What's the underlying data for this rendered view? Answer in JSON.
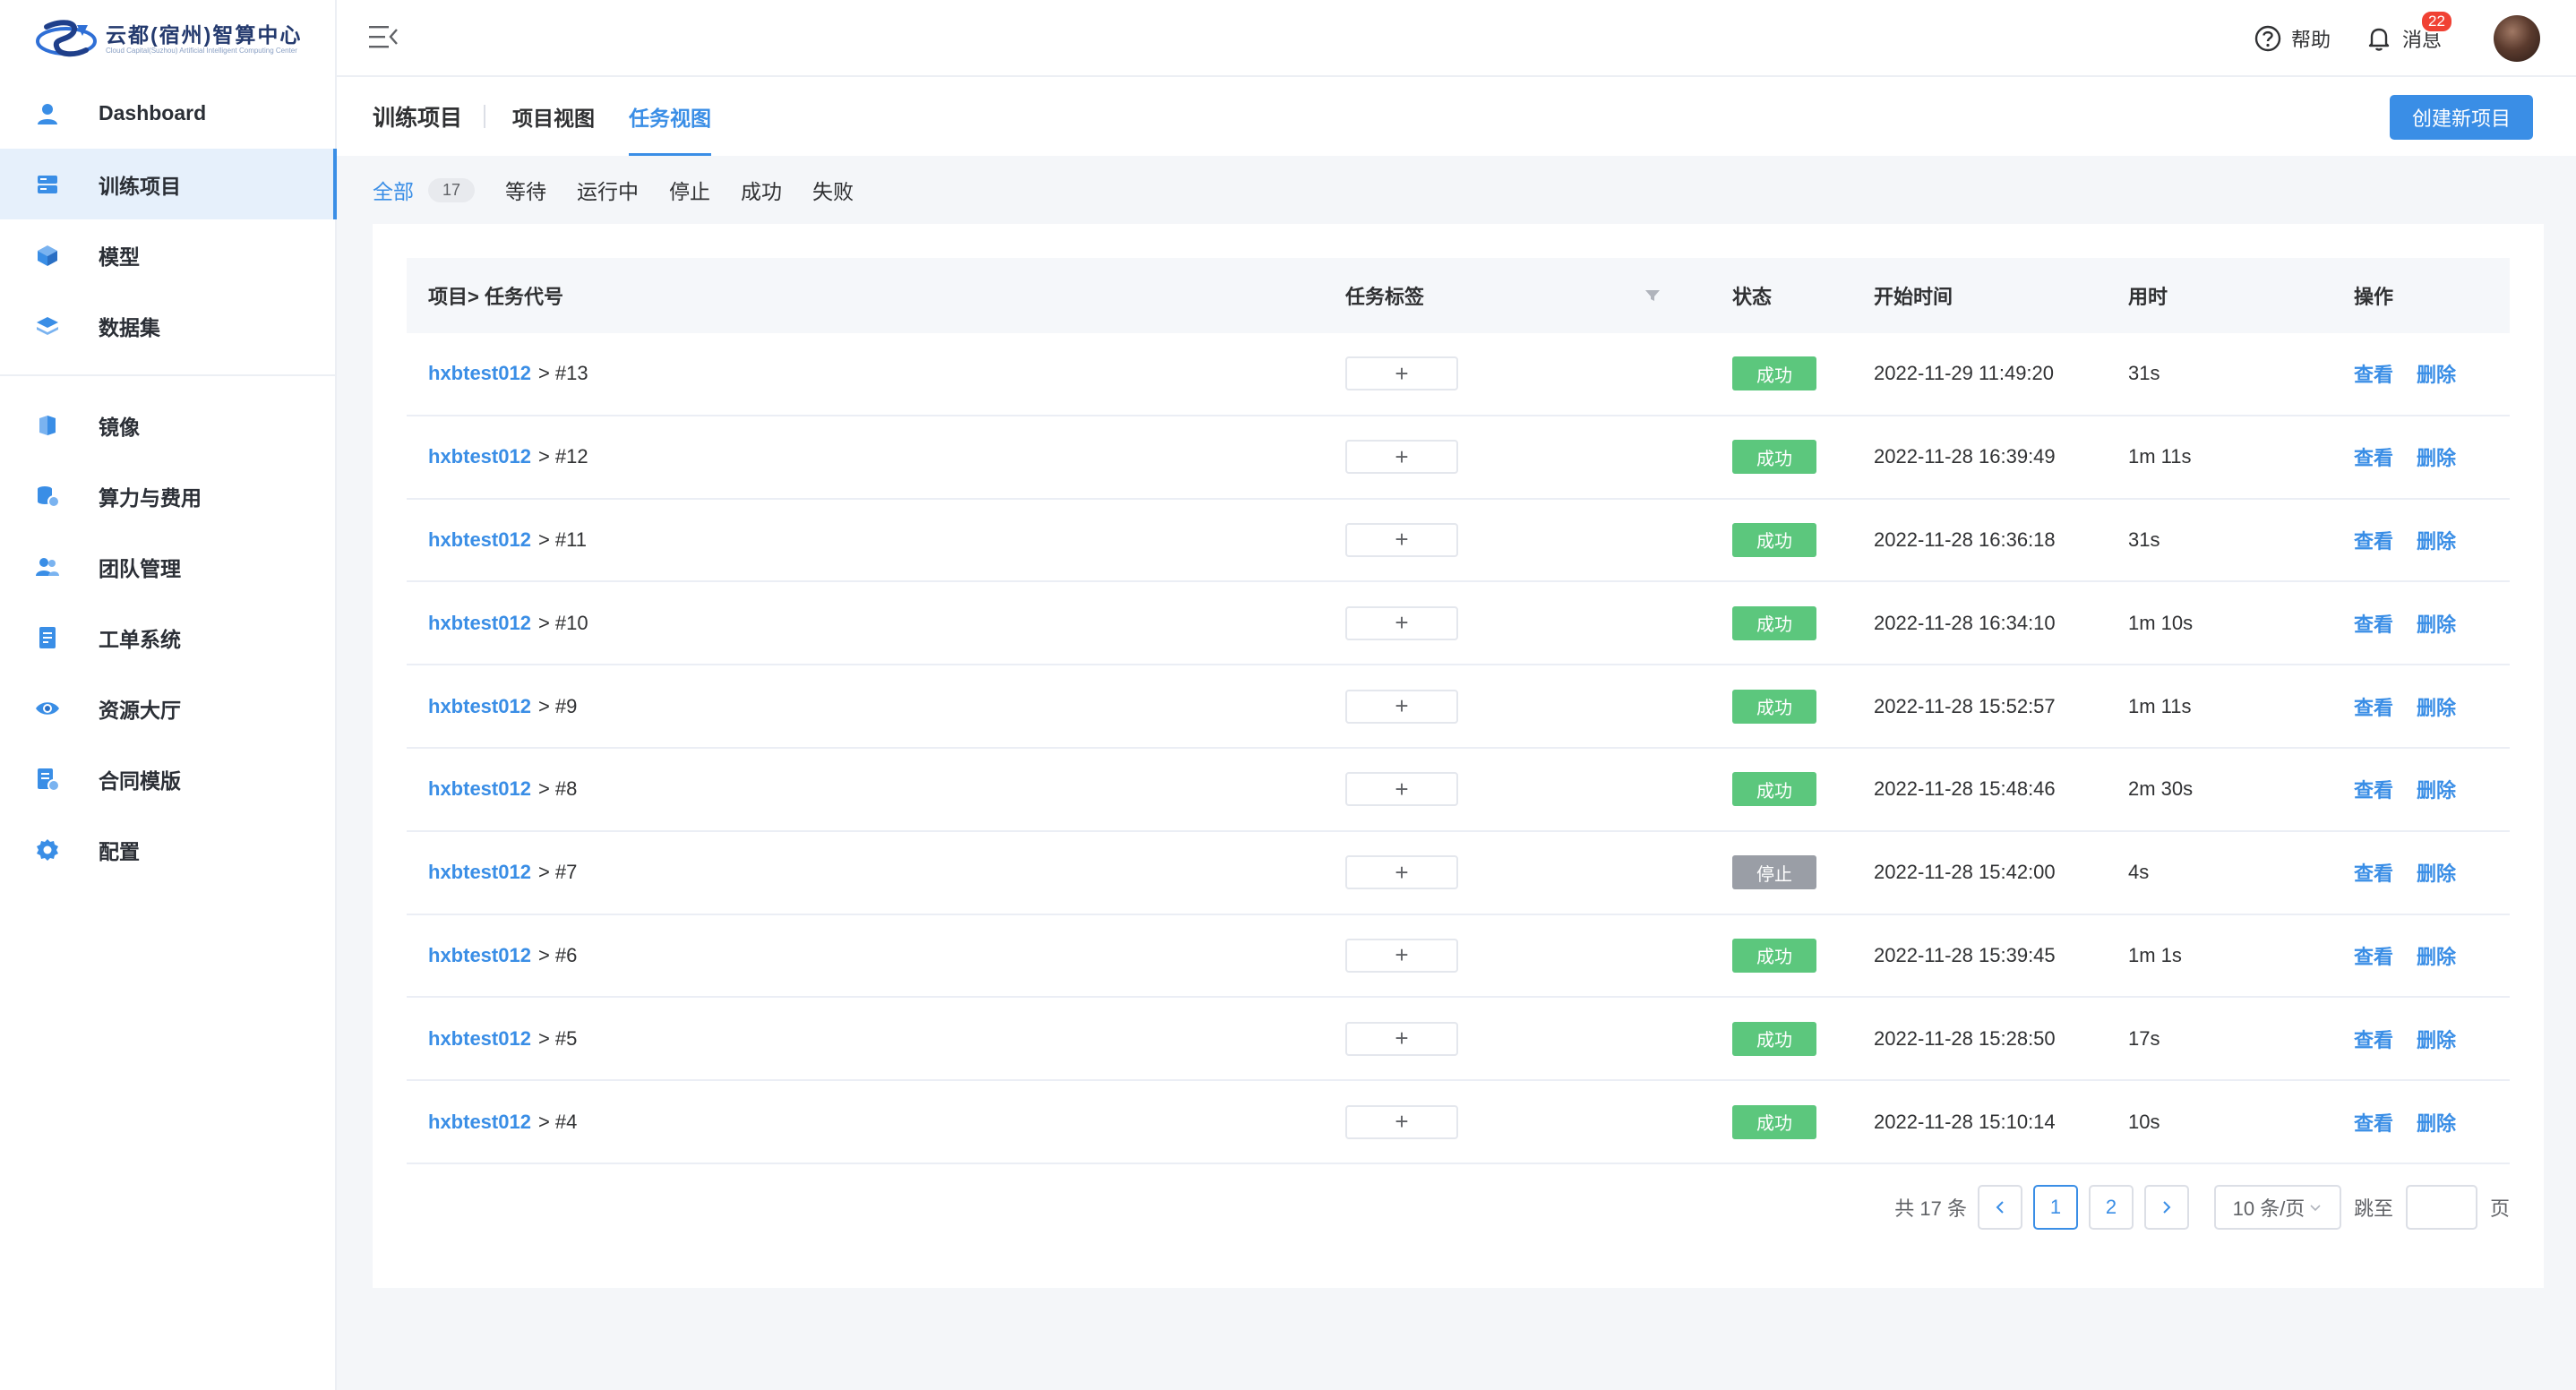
{
  "brand": {
    "title": "云都(宿州)智算中心",
    "subtitle": "Cloud Capital(Suzhou) Artificial Intelligent Computing Center"
  },
  "sidebar": {
    "items": [
      {
        "label": "Dashboard",
        "icon": "user-icon"
      },
      {
        "label": "训练项目",
        "icon": "server-icon",
        "active": true
      },
      {
        "label": "模型",
        "icon": "cube-icon"
      },
      {
        "label": "数据集",
        "icon": "layers-icon"
      },
      {
        "label": "镜像",
        "icon": "shield-icon"
      },
      {
        "label": "算力与费用",
        "icon": "compute-cost-icon"
      },
      {
        "label": "团队管理",
        "icon": "team-icon"
      },
      {
        "label": "工单系统",
        "icon": "ticket-icon"
      },
      {
        "label": "资源大厅",
        "icon": "eye-icon"
      },
      {
        "label": "合同模版",
        "icon": "contract-icon"
      },
      {
        "label": "配置",
        "icon": "gear-icon"
      }
    ]
  },
  "header": {
    "help_label": "帮助",
    "messages_label": "消息",
    "messages_count": "22"
  },
  "subheader": {
    "title": "训练项目",
    "tabs": [
      {
        "label": "项目视图",
        "active": false
      },
      {
        "label": "任务视图",
        "active": true
      }
    ],
    "create_label": "创建新项目"
  },
  "filters": {
    "all_label": "全部",
    "all_count": "17",
    "items": [
      "等待",
      "运行中",
      "停止",
      "成功",
      "失败"
    ]
  },
  "table": {
    "columns": {
      "task": "项目> 任务代号",
      "tags": "任务标签",
      "status": "状态",
      "start": "开始时间",
      "duration": "用时",
      "ops": "操作"
    },
    "add_tag_label": "+",
    "view_label": "查看",
    "delete_label": "删除",
    "status_colors": {
      "成功": "#5cc77d",
      "停止": "#9a9ea6"
    },
    "rows": [
      {
        "project": "hxbtest012",
        "code": "> #13",
        "status": "成功",
        "start": "2022-11-29 11:49:20",
        "duration": "31s"
      },
      {
        "project": "hxbtest012",
        "code": "> #12",
        "status": "成功",
        "start": "2022-11-28 16:39:49",
        "duration": "1m 11s"
      },
      {
        "project": "hxbtest012",
        "code": "> #11",
        "status": "成功",
        "start": "2022-11-28 16:36:18",
        "duration": "31s"
      },
      {
        "project": "hxbtest012",
        "code": "> #10",
        "status": "成功",
        "start": "2022-11-28 16:34:10",
        "duration": "1m 10s"
      },
      {
        "project": "hxbtest012",
        "code": "> #9",
        "status": "成功",
        "start": "2022-11-28 15:52:57",
        "duration": "1m 11s"
      },
      {
        "project": "hxbtest012",
        "code": "> #8",
        "status": "成功",
        "start": "2022-11-28 15:48:46",
        "duration": "2m 30s"
      },
      {
        "project": "hxbtest012",
        "code": "> #7",
        "status": "停止",
        "start": "2022-11-28 15:42:00",
        "duration": "4s"
      },
      {
        "project": "hxbtest012",
        "code": "> #6",
        "status": "成功",
        "start": "2022-11-28 15:39:45",
        "duration": "1m 1s"
      },
      {
        "project": "hxbtest012",
        "code": "> #5",
        "status": "成功",
        "start": "2022-11-28 15:28:50",
        "duration": "17s"
      },
      {
        "project": "hxbtest012",
        "code": "> #4",
        "status": "成功",
        "start": "2022-11-28 15:10:14",
        "duration": "10s"
      }
    ]
  },
  "pagination": {
    "total_label": "共 17 条",
    "pages": [
      "1",
      "2"
    ],
    "current": "1",
    "prev": "<",
    "next": ">",
    "page_size": "10 条/页",
    "jump_label": "跳至",
    "page_unit": "页"
  }
}
